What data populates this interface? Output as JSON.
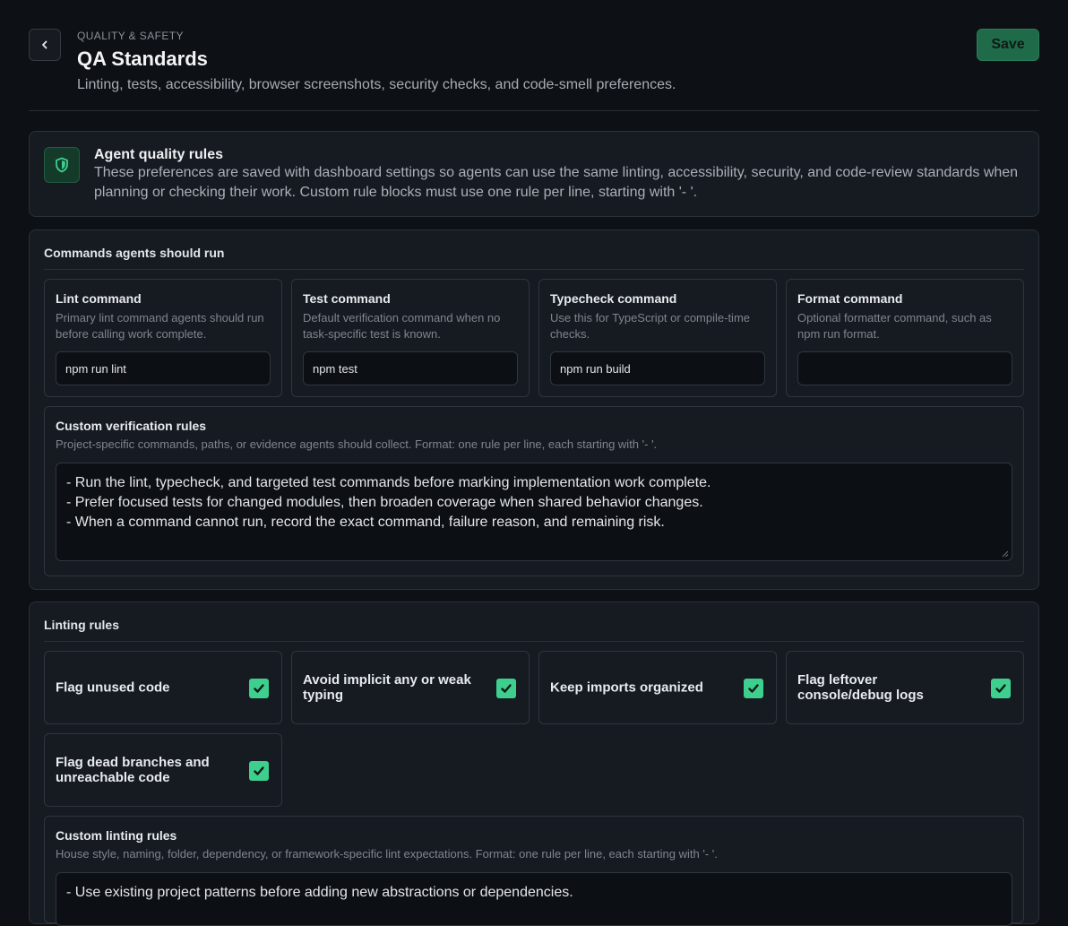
{
  "header": {
    "eyebrow": "QUALITY & SAFETY",
    "title": "QA Standards",
    "subtitle": "Linting, tests, accessibility, browser screenshots, security checks, and code-smell preferences.",
    "save_label": "Save",
    "back_icon": "chevron-left-icon"
  },
  "info": {
    "icon": "shield-icon",
    "title": "Agent quality rules",
    "body": "These preferences are saved with dashboard settings so agents can use the same linting, accessibility, security, and code-review standards when planning or checking their work. Custom rule blocks must use one rule per line, starting with '- '."
  },
  "commands": {
    "title": "Commands agents should run",
    "items": [
      {
        "label": "Lint command",
        "help": "Primary lint command agents should run before calling work complete.",
        "value": "npm run lint",
        "placeholder": ""
      },
      {
        "label": "Test command",
        "help": "Default verification command when no task-specific test is known.",
        "value": "npm test",
        "placeholder": ""
      },
      {
        "label": "Typecheck command",
        "help": "Use this for TypeScript or compile-time checks.",
        "value": "npm run build",
        "placeholder": ""
      },
      {
        "label": "Format command",
        "help": "Optional formatter command, such as npm run format.",
        "value": "",
        "placeholder": ""
      }
    ],
    "custom": {
      "label": "Custom verification rules",
      "help": "Project-specific commands, paths, or evidence agents should collect. Format: one rule per line, each starting with '- '.",
      "lines": [
        "- Run the lint, typecheck, and targeted test commands before marking implementation work complete.",
        "- Prefer focused tests for changed modules, then broaden coverage when shared behavior changes.",
        "- When a command cannot run, record the exact command, failure reason, and remaining risk."
      ]
    }
  },
  "linting": {
    "title": "Linting rules",
    "toggles": [
      {
        "label": "Flag unused code",
        "checked": true
      },
      {
        "label": "Avoid implicit any or weak typing",
        "checked": true
      },
      {
        "label": "Keep imports organized",
        "checked": true
      },
      {
        "label": "Flag leftover console/debug logs",
        "checked": true
      },
      {
        "label": "Flag dead branches and unreachable code",
        "checked": true
      }
    ],
    "custom": {
      "label": "Custom linting rules",
      "help": "House style, naming, folder, dependency, or framework-specific lint expectations. Format: one rule per line, each starting with '- '.",
      "lines": [
        "- Use existing project patterns before adding new abstractions or dependencies."
      ]
    }
  },
  "colors": {
    "accent": "#3ecf8e",
    "save_bg": "#1f6b49",
    "background": "#0d1014",
    "card": "#161b22"
  }
}
